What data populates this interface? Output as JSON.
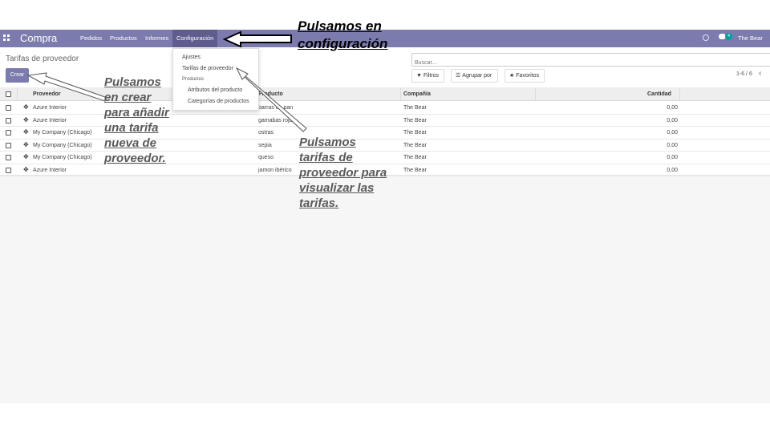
{
  "navbar": {
    "app_name": "Compra",
    "menus": [
      "Pedidos",
      "Productos",
      "Informes",
      "Configuración"
    ],
    "chat_count": "4",
    "company": "The Bear",
    "color": "#7c7bad"
  },
  "breadcrumb": "Tarifas de proveedor",
  "create_label": "Crear",
  "search": {
    "placeholder": "Buscar..."
  },
  "filters": {
    "filters_label": "Filtros",
    "group_label": "Agrupar por",
    "favorites_label": "Favoritos"
  },
  "pager": "1-6 / 6",
  "table": {
    "headers": [
      "Proveedor",
      "Producto",
      "Compañía",
      "Cantidad"
    ],
    "rows": [
      {
        "vendor": "Azure Interior",
        "product": "barras de pan",
        "company": "The Bear",
        "qty": "0,00"
      },
      {
        "vendor": "Azure Interior",
        "product": "gamabas rojas",
        "company": "The Bear",
        "qty": "0,00"
      },
      {
        "vendor": "My Company (Chicago)",
        "product": "ostras",
        "company": "The Bear",
        "qty": "0,00"
      },
      {
        "vendor": "My Company (Chicago)",
        "product": "sepia",
        "company": "The Bear",
        "qty": "0,00"
      },
      {
        "vendor": "My Company (Chicago)",
        "product": "queso",
        "company": "The Bear",
        "qty": "0,00"
      },
      {
        "vendor": "Azure Interior",
        "product": "jamon ibérico",
        "company": "The Bear",
        "qty": "0,00"
      }
    ]
  },
  "dropdown": {
    "settings": "Ajustes",
    "vendor_pricelists": "Tarifas de proveedor",
    "products_header": "Productos",
    "product_attributes": "Atributos del producto",
    "product_categories": "Categorías de productos"
  },
  "annotations": {
    "config": [
      "Pulsamos en",
      "configuración"
    ],
    "create": [
      "Pulsamos",
      "en crear",
      "para añadir",
      "una tarifa",
      "nueva de",
      "proveedor."
    ],
    "pricelists": [
      "Pulsamos",
      "tarifas de",
      "proveedor para",
      "visualizar las",
      "tarifas."
    ]
  }
}
